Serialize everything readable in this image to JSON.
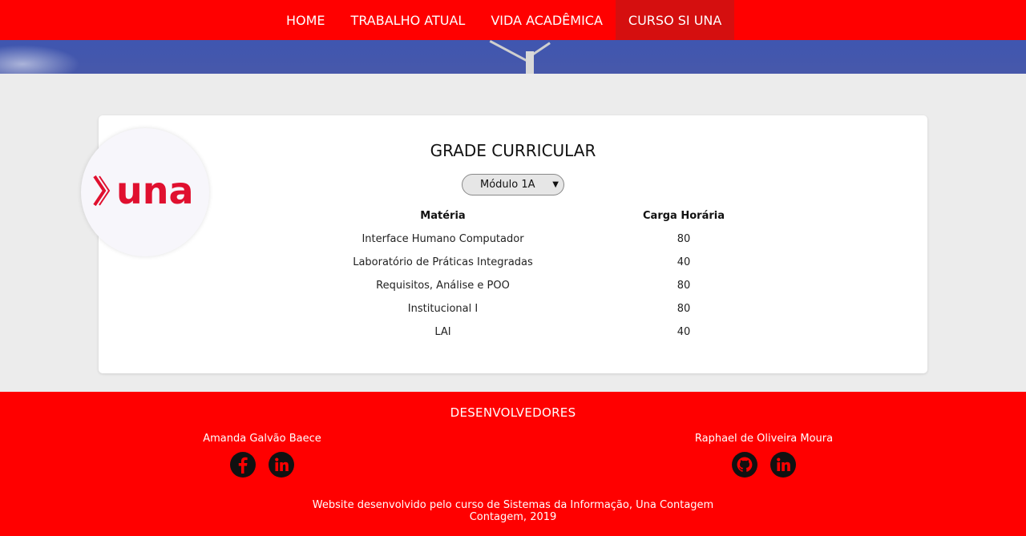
{
  "nav": {
    "items": [
      {
        "label": "HOME"
      },
      {
        "label": "TRABALHO ATUAL"
      },
      {
        "label": "VIDA ACADÊMICA"
      },
      {
        "label": "CURSO SI UNA"
      }
    ],
    "active": "CURSO SI UNA"
  },
  "logo": {
    "text": "una",
    "brand_color": "#e0102f"
  },
  "card": {
    "title": "GRADE CURRICULAR",
    "module_select": {
      "selected": "Módulo 1A"
    },
    "columns": [
      "Matéria",
      "Carga Horária"
    ],
    "rows": [
      {
        "materia": "Interface Humano Computador",
        "carga": "80"
      },
      {
        "materia": "Laboratório de Práticas Integradas",
        "carga": "40"
      },
      {
        "materia": "Requisitos, Análise e POO",
        "carga": "80"
      },
      {
        "materia": "Institucional I",
        "carga": "80"
      },
      {
        "materia": "LAI",
        "carga": "40"
      }
    ]
  },
  "footer": {
    "title": "DESENVOLVEDORES",
    "developers": [
      {
        "name": "Amanda Galvão Baece",
        "icons": [
          "facebook-icon",
          "linkedin-icon"
        ]
      },
      {
        "name": "Raphael de Oliveira Moura",
        "icons": [
          "github-icon",
          "linkedin-icon"
        ]
      }
    ],
    "credit_line1": "Website desenvolvido pelo curso de Sistemas da Informação, Una Contagem",
    "credit_line2": "Contagem, 2019"
  },
  "colors": {
    "nav_bg": "#ff0000",
    "nav_active": "#d50f0f",
    "footer_bg": "#ff0000",
    "page_bg": "#ececec"
  }
}
